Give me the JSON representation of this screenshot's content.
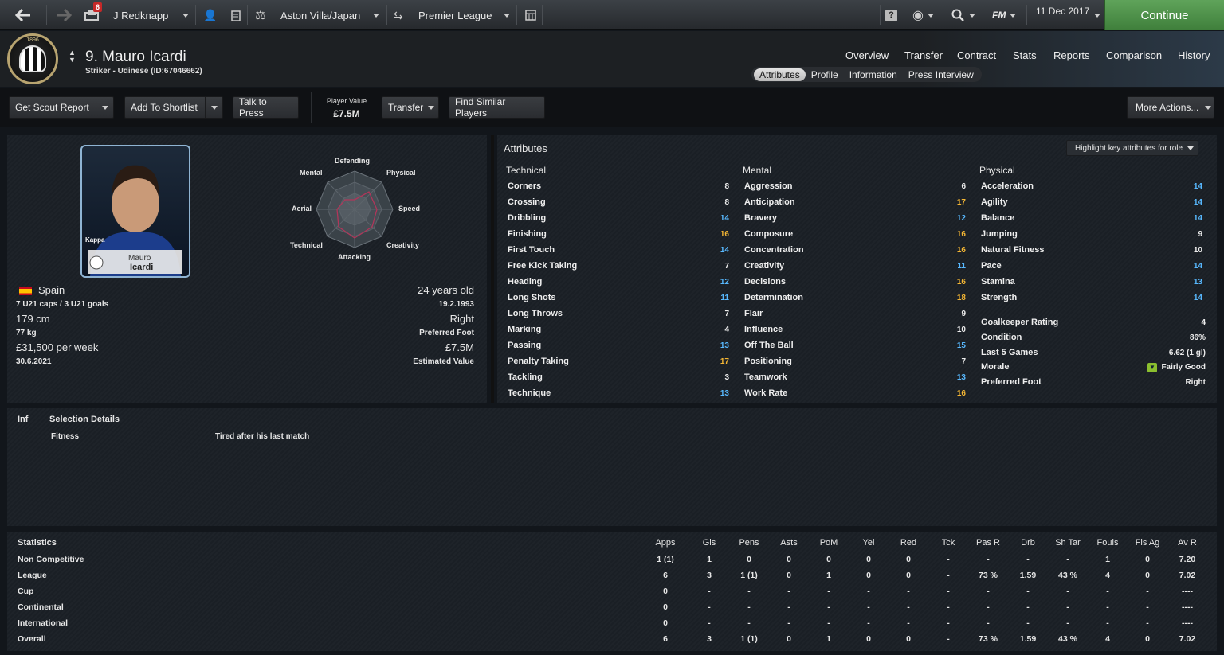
{
  "topbar": {
    "notifications": "6",
    "manager": "J Redknapp",
    "club": "Aston Villa/Japan",
    "competition": "Premier League",
    "fm_label": "FM",
    "date": "11 Dec 2017",
    "continue_label": "Continue"
  },
  "header": {
    "player_name": "9. Mauro Icardi",
    "player_sub": "Striker - Udinese (ID:67046662)",
    "nav": [
      "Overview",
      "Transfer",
      "Contract",
      "Stats",
      "Reports",
      "Comparison",
      "History"
    ],
    "subtabs": [
      "Attributes",
      "Profile",
      "Information",
      "Press Interview"
    ],
    "active_subtab": "Attributes",
    "crest_year": "1896"
  },
  "actions": {
    "scout": "Get Scout Report",
    "shortlist": "Add To Shortlist",
    "press": "Talk to Press",
    "value_label": "Player Value",
    "value": "£7.5M",
    "transfer": "Transfer",
    "similar": "Find Similar Players",
    "more": "More Actions..."
  },
  "profile": {
    "photo_caption_1": "Mauro",
    "photo_caption_2": "Icardi",
    "photo_brand": "Kappa",
    "radar_labels": {
      "top": "Defending",
      "topright": "Physical",
      "right": "Speed",
      "bottomright": "Creativity",
      "bottom": "Attacking",
      "bottomleft": "Technical",
      "left": "Aerial",
      "topleft": "Mental"
    },
    "nationality": "Spain",
    "caps": "7 U21 caps / 3 U21 goals",
    "height": "179 cm",
    "weight": "77 kg",
    "wage": "£31,500 per week",
    "contract": "30.6.2021",
    "age": "24 years old",
    "dob": "19.2.1993",
    "foot": "Right",
    "foot_label": "Preferred Foot",
    "est_value": "£7.5M",
    "est_value_label": "Estimated Value"
  },
  "attributes": {
    "title": "Attributes",
    "highlight": "Highlight key attributes for role",
    "technical_title": "Technical",
    "mental_title": "Mental",
    "physical_title": "Physical",
    "technical": [
      {
        "name": "Corners",
        "value": "8",
        "tone": "w"
      },
      {
        "name": "Crossing",
        "value": "8",
        "tone": "w"
      },
      {
        "name": "Dribbling",
        "value": "14",
        "tone": "b"
      },
      {
        "name": "Finishing",
        "value": "16",
        "tone": "y"
      },
      {
        "name": "First Touch",
        "value": "14",
        "tone": "b"
      },
      {
        "name": "Free Kick Taking",
        "value": "7",
        "tone": "w"
      },
      {
        "name": "Heading",
        "value": "12",
        "tone": "b"
      },
      {
        "name": "Long Shots",
        "value": "11",
        "tone": "b"
      },
      {
        "name": "Long Throws",
        "value": "7",
        "tone": "w"
      },
      {
        "name": "Marking",
        "value": "4",
        "tone": "w"
      },
      {
        "name": "Passing",
        "value": "13",
        "tone": "b"
      },
      {
        "name": "Penalty Taking",
        "value": "17",
        "tone": "y"
      },
      {
        "name": "Tackling",
        "value": "3",
        "tone": "w"
      },
      {
        "name": "Technique",
        "value": "13",
        "tone": "b"
      }
    ],
    "mental": [
      {
        "name": "Aggression",
        "value": "6",
        "tone": "w"
      },
      {
        "name": "Anticipation",
        "value": "17",
        "tone": "y"
      },
      {
        "name": "Bravery",
        "value": "12",
        "tone": "b"
      },
      {
        "name": "Composure",
        "value": "16",
        "tone": "y"
      },
      {
        "name": "Concentration",
        "value": "16",
        "tone": "y"
      },
      {
        "name": "Creativity",
        "value": "11",
        "tone": "b"
      },
      {
        "name": "Decisions",
        "value": "16",
        "tone": "y"
      },
      {
        "name": "Determination",
        "value": "18",
        "tone": "y"
      },
      {
        "name": "Flair",
        "value": "9",
        "tone": "w"
      },
      {
        "name": "Influence",
        "value": "10",
        "tone": "w"
      },
      {
        "name": "Off The Ball",
        "value": "15",
        "tone": "b"
      },
      {
        "name": "Positioning",
        "value": "7",
        "tone": "w"
      },
      {
        "name": "Teamwork",
        "value": "13",
        "tone": "b"
      },
      {
        "name": "Work Rate",
        "value": "16",
        "tone": "y"
      }
    ],
    "physical": [
      {
        "name": "Acceleration",
        "value": "14",
        "tone": "b"
      },
      {
        "name": "Agility",
        "value": "14",
        "tone": "b"
      },
      {
        "name": "Balance",
        "value": "14",
        "tone": "b"
      },
      {
        "name": "Jumping",
        "value": "9",
        "tone": "w"
      },
      {
        "name": "Natural Fitness",
        "value": "10",
        "tone": "w"
      },
      {
        "name": "Pace",
        "value": "14",
        "tone": "b"
      },
      {
        "name": "Stamina",
        "value": "13",
        "tone": "b"
      },
      {
        "name": "Strength",
        "value": "14",
        "tone": "b"
      }
    ],
    "extra": [
      {
        "name": "Goalkeeper Rating",
        "value": "4"
      },
      {
        "name": "Condition",
        "value": "86%"
      },
      {
        "name": "Last 5 Games",
        "value": "6.62 (1 gl)"
      },
      {
        "name": "Morale",
        "value": "Fairly Good"
      },
      {
        "name": "Preferred Foot",
        "value": "Right"
      }
    ]
  },
  "selection": {
    "inf": "Inf",
    "title": "Selection Details",
    "label": "Fitness",
    "value": "Tired after his last match"
  },
  "statistics": {
    "title": "Statistics",
    "columns": [
      "Apps",
      "Gls",
      "Pens",
      "Asts",
      "PoM",
      "Yel",
      "Red",
      "Tck",
      "Pas R",
      "Drb",
      "Sh Tar",
      "Fouls",
      "Fls Ag",
      "Av R"
    ],
    "rows": [
      {
        "label": "Non Competitive",
        "cells": [
          "1 (1)",
          "1",
          "0",
          "0",
          "0",
          "0",
          "0",
          "-",
          "-",
          "-",
          "-",
          "1",
          "0",
          "7.20"
        ]
      },
      {
        "label": "League",
        "cells": [
          "6",
          "3",
          "1 (1)",
          "0",
          "1",
          "0",
          "0",
          "-",
          "73 %",
          "1.59",
          "43 %",
          "4",
          "0",
          "7.02"
        ]
      },
      {
        "label": "Cup",
        "cells": [
          "0",
          "-",
          "-",
          "-",
          "-",
          "-",
          "-",
          "-",
          "-",
          "-",
          "-",
          "-",
          "-",
          "----"
        ]
      },
      {
        "label": "Continental",
        "cells": [
          "0",
          "-",
          "-",
          "-",
          "-",
          "-",
          "-",
          "-",
          "-",
          "-",
          "-",
          "-",
          "-",
          "----"
        ]
      },
      {
        "label": "International",
        "cells": [
          "0",
          "-",
          "-",
          "-",
          "-",
          "-",
          "-",
          "-",
          "-",
          "-",
          "-",
          "-",
          "-",
          "----"
        ]
      },
      {
        "label": "Overall",
        "cells": [
          "6",
          "3",
          "1 (1)",
          "0",
          "1",
          "0",
          "0",
          "-",
          "73 %",
          "1.59",
          "43 %",
          "4",
          "0",
          "7.02"
        ]
      }
    ]
  },
  "colors": {
    "accent_green": "#4e9449",
    "value_blue": "#58b9ff",
    "value_yellow": "#f4b634"
  }
}
